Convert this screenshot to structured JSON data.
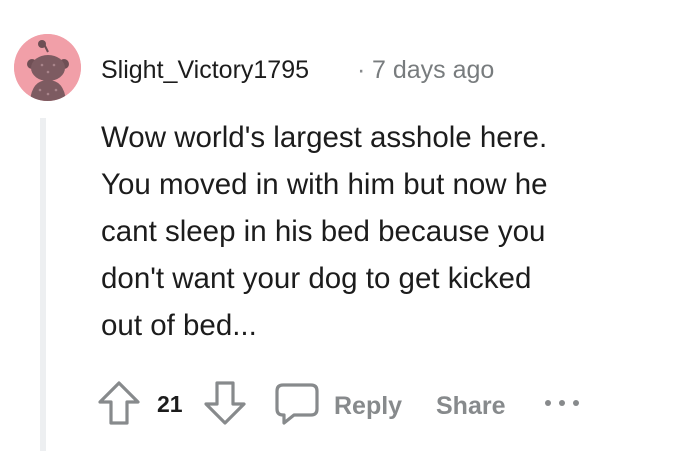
{
  "comment": {
    "author": "Slight_Victory1795",
    "separator": "·",
    "timestamp": "7 days ago",
    "body_lines": [
      "Wow world's largest asshole here.",
      "You moved in with him but now he",
      "cant sleep in his bed because you",
      "don't want your dog to get kicked",
      "out of bed..."
    ],
    "score": "21"
  },
  "actions": {
    "reply_label": "Reply",
    "share_label": "Share"
  },
  "icons": {
    "avatar": "snoo-avatar",
    "upvote": "upvote-arrow-icon",
    "downvote": "downvote-arrow-icon",
    "reply": "comment-bubble-icon",
    "more": "more-dots-icon"
  },
  "colors": {
    "avatar_background": "#f19fa8",
    "muted_text": "#878a8c",
    "body_text": "#1c1c1c",
    "thread_line": "#edeff1"
  }
}
